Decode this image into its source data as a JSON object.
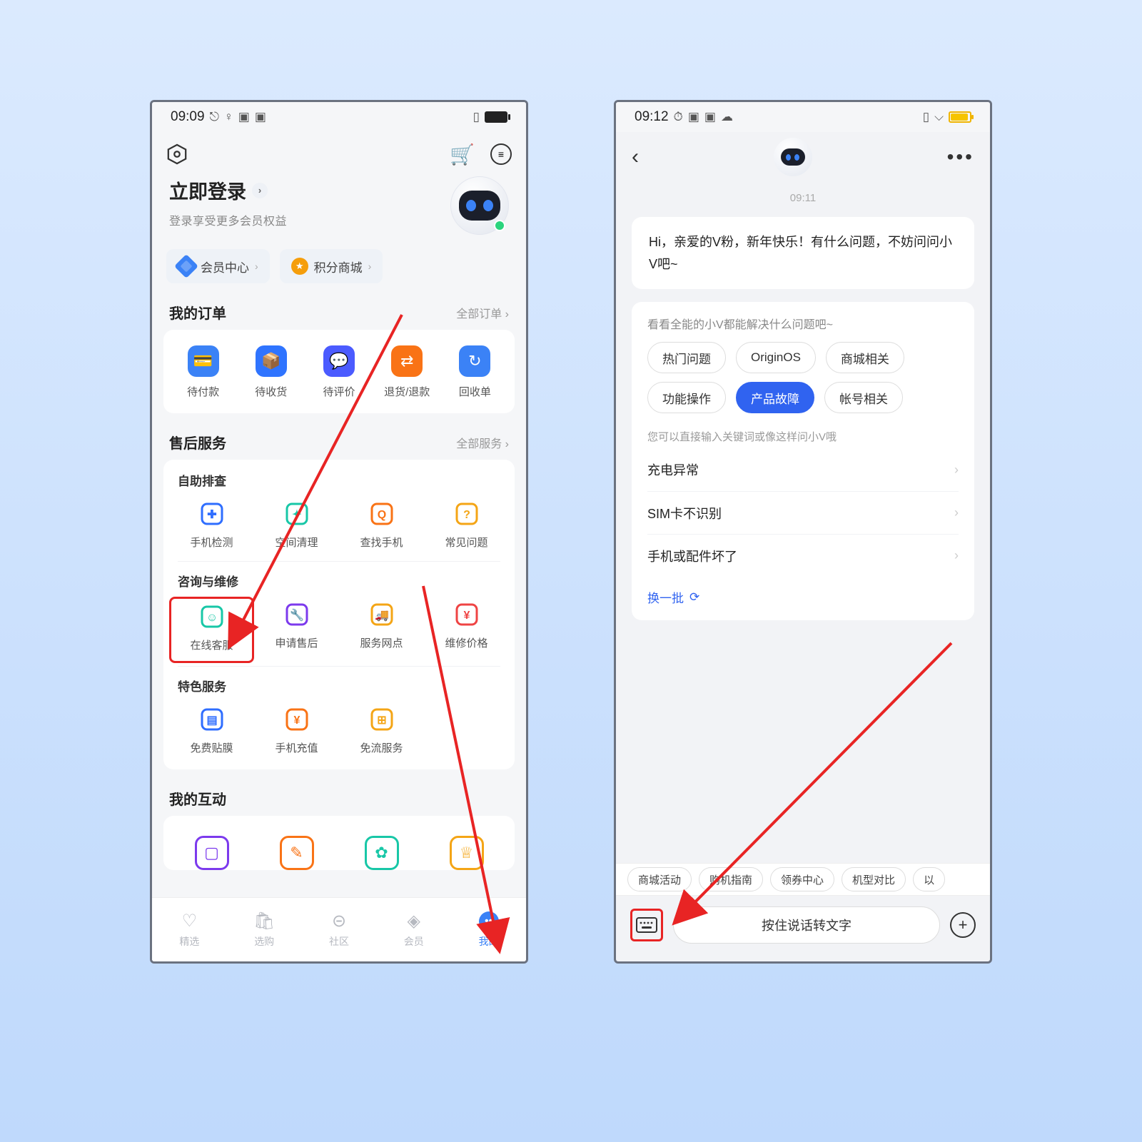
{
  "left": {
    "status_time": "09:09",
    "login_title": "立即登录",
    "login_sub": "登录享受更多会员权益",
    "pills": {
      "vip": "会员中心",
      "mall": "积分商城"
    },
    "orders": {
      "title": "我的订单",
      "more": "全部订单 ",
      "items": [
        {
          "label": "待付款",
          "color": "#3b82f6",
          "glyph": "💳"
        },
        {
          "label": "待收货",
          "color": "#2f74ff",
          "glyph": "📦"
        },
        {
          "label": "待评价",
          "color": "#4b5bff",
          "glyph": "💬"
        },
        {
          "label": "退货/退款",
          "color": "#f97316",
          "glyph": "⇄"
        },
        {
          "label": "回收单",
          "color": "#3b82f6",
          "glyph": "↻"
        }
      ]
    },
    "service": {
      "title": "售后服务",
      "more": "全部服务 ",
      "g1_title": "自助排查",
      "g1": [
        {
          "label": "手机检测",
          "glyph": "✚",
          "color": "#2f6eff"
        },
        {
          "label": "空间清理",
          "glyph": "✦",
          "color": "#18c7a7"
        },
        {
          "label": "查找手机",
          "glyph": "Q",
          "color": "#f97316"
        },
        {
          "label": "常见问题",
          "glyph": "?",
          "color": "#f4a516"
        }
      ],
      "g2_title": "咨询与维修",
      "g2": [
        {
          "label": "在线客服",
          "glyph": "☺",
          "color": "#18c7a7"
        },
        {
          "label": "申请售后",
          "glyph": "🔧",
          "color": "#7c3aed"
        },
        {
          "label": "服务网点",
          "glyph": "🚚",
          "color": "#f4a516"
        },
        {
          "label": "维修价格",
          "glyph": "¥",
          "color": "#ef4444"
        }
      ],
      "g3_title": "特色服务",
      "g3": [
        {
          "label": "免费贴膜",
          "glyph": "▤",
          "color": "#2f6eff"
        },
        {
          "label": "手机充值",
          "glyph": "¥",
          "color": "#f97316"
        },
        {
          "label": "免流服务",
          "glyph": "⊞",
          "color": "#f4a516"
        }
      ]
    },
    "interactions": {
      "title": "我的互动",
      "items": [
        {
          "color": "#7c3aed",
          "glyph": "▢"
        },
        {
          "color": "#f97316",
          "glyph": "✎"
        },
        {
          "color": "#18c7a7",
          "glyph": "✿"
        },
        {
          "color": "#f4a516",
          "glyph": "♕"
        }
      ]
    },
    "tabs": [
      {
        "label": "精选",
        "glyph": "♡"
      },
      {
        "label": "选购",
        "glyph": "🛍"
      },
      {
        "label": "社区",
        "glyph": "⊝"
      },
      {
        "label": "会员",
        "glyph": "◈"
      },
      {
        "label": "我的",
        "glyph": "••"
      }
    ]
  },
  "right": {
    "status_time": "09:12",
    "chat_time": "09:11",
    "greeting": "Hi，亲爱的V粉，新年快乐！有什么问题，不妨问问小V吧~",
    "panel_h": "看看全能的小V都能解决什么问题吧~",
    "chips": [
      "热门问题",
      "OriginOS",
      "商城相关",
      "功能操作",
      "产品故障",
      "帐号相关"
    ],
    "chip_selected": 4,
    "panel_sub": "您可以直接输入关键词或像这样问小V哦",
    "rows": [
      "充电异常",
      "SIM卡不识别",
      "手机或配件坏了"
    ],
    "swap": "换一批",
    "suggestions": [
      "商城活动",
      "购机指南",
      "领券中心",
      "机型对比",
      "以"
    ],
    "voice": "按住说话转文字"
  }
}
